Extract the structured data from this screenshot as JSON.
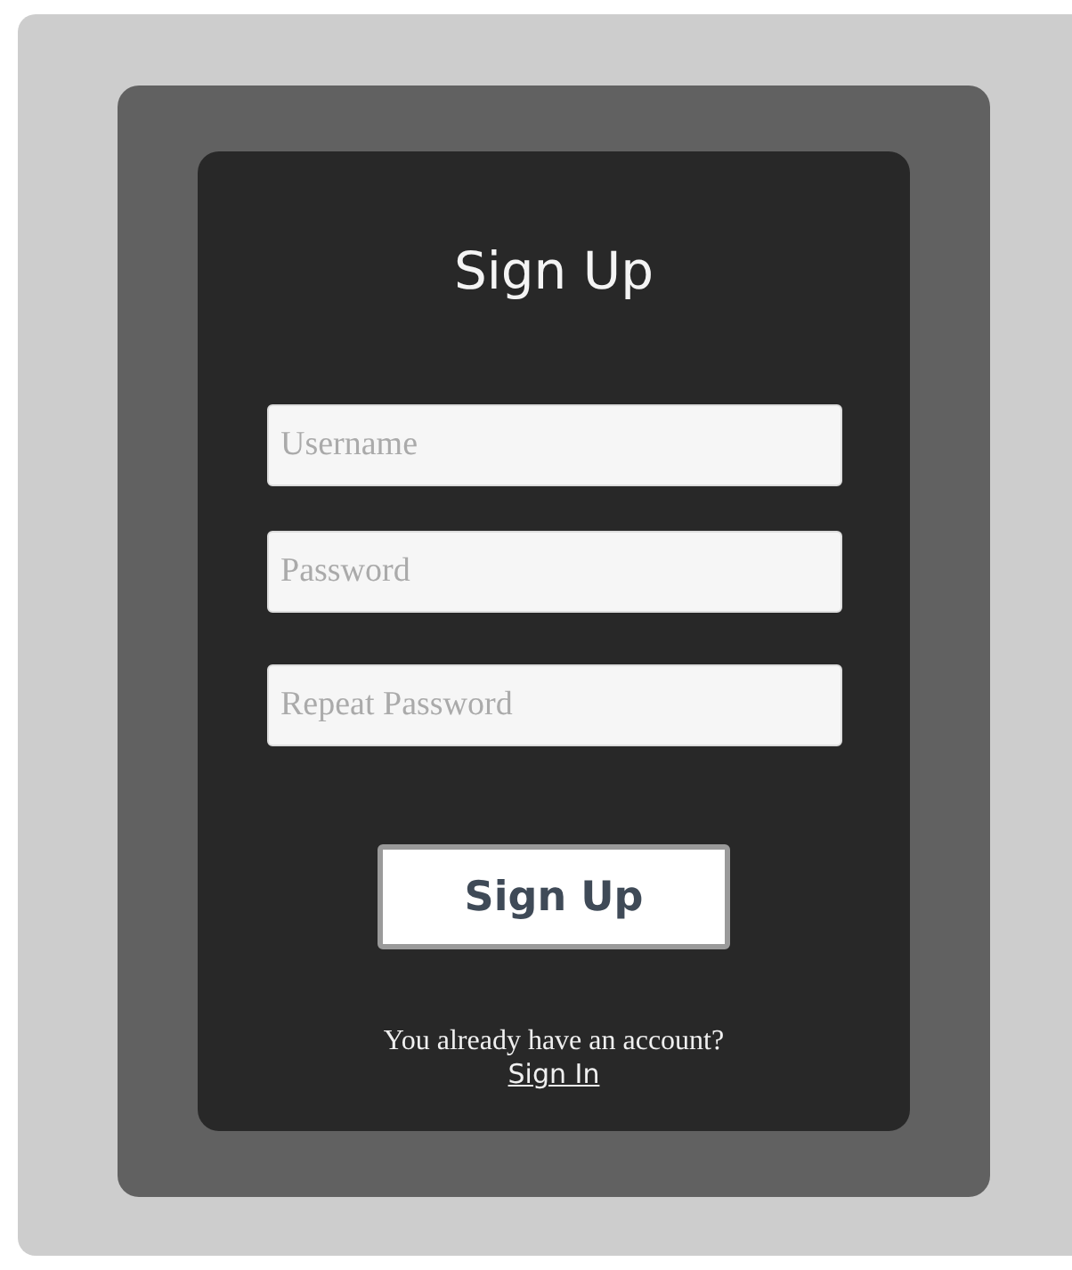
{
  "title": "Sign Up",
  "fields": [
    {
      "placeholder": "Username"
    },
    {
      "placeholder": "Password"
    },
    {
      "placeholder": "Repeat Password"
    }
  ],
  "submit": "Sign Up",
  "prompt": "You already have an account?",
  "link": "Sign In"
}
